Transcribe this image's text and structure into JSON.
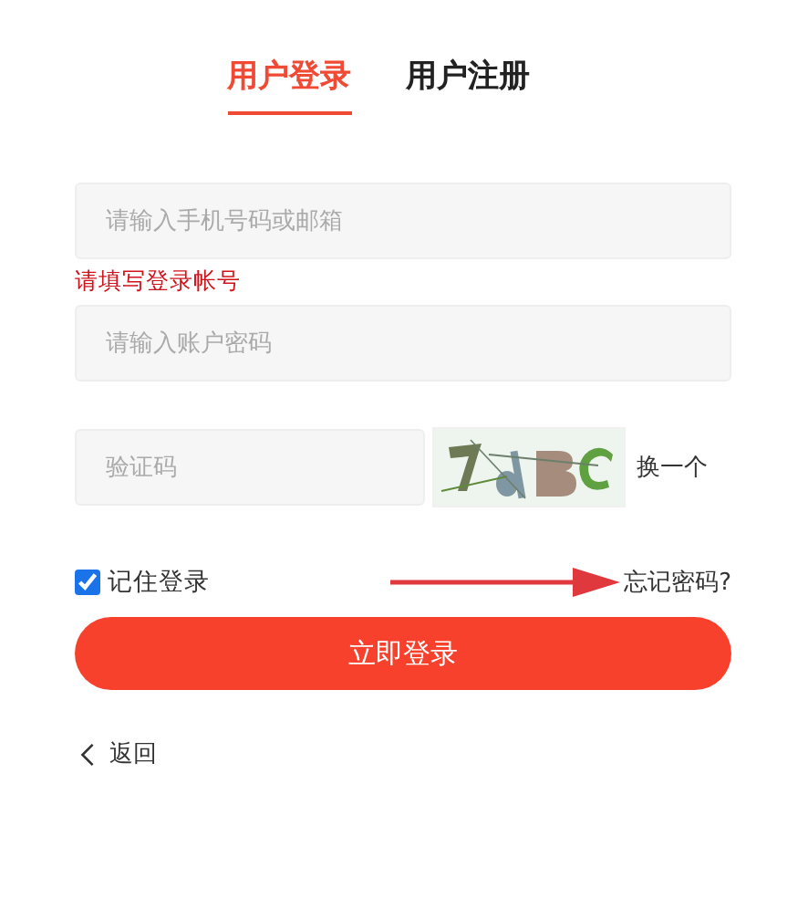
{
  "tabs": [
    {
      "label": "用户登录",
      "selected": true
    },
    {
      "label": "用户注册",
      "selected": false
    }
  ],
  "account_field": {
    "placeholder": "请输入手机号码或邮箱"
  },
  "account_error": "请填写登录帐号",
  "password_field": {
    "placeholder": "请输入账户密码"
  },
  "captcha_field": {
    "placeholder": "验证码"
  },
  "captcha_refresh": "换一个",
  "remember": {
    "label": "记住登录",
    "checked": true
  },
  "forgot_link": "忘记密码?",
  "login_button": "立即登录",
  "back_link": "返回"
}
